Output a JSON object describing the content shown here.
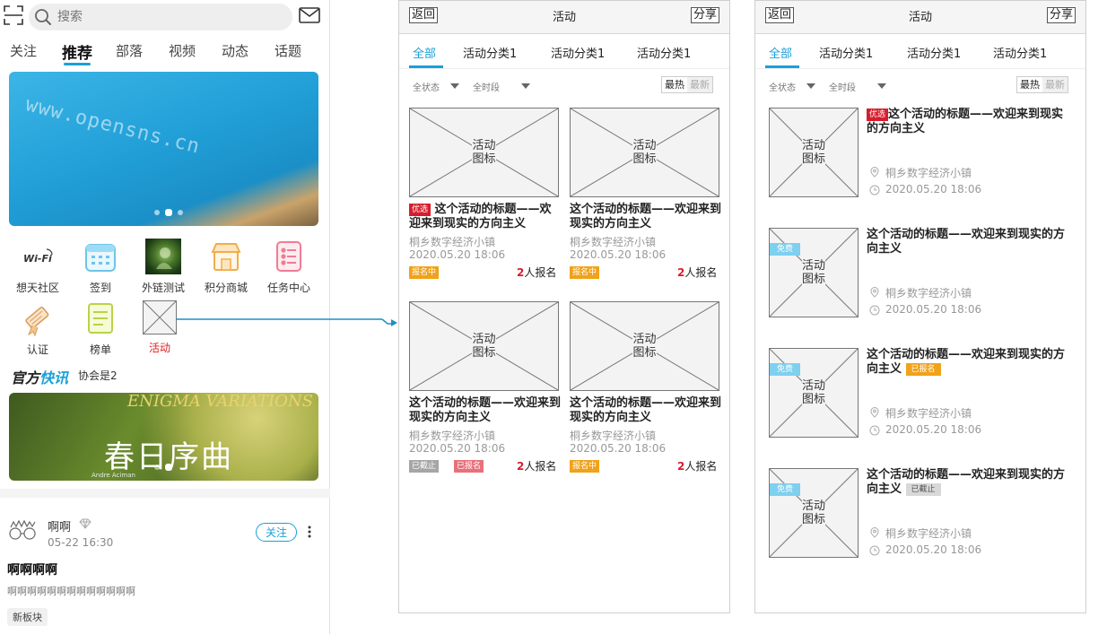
{
  "left": {
    "search_placeholder": "搜索",
    "tabs": [
      "关注",
      "推荐",
      "部落",
      "视频",
      "动态",
      "话题"
    ],
    "banner_watermark": "www.opensns.cn",
    "grid": [
      {
        "label": "想天社区",
        "icon": "wifi-logo-icon"
      },
      {
        "label": "签到",
        "icon": "calendar-icon"
      },
      {
        "label": "外链测试",
        "icon": "thumbnail-image-icon"
      },
      {
        "label": "积分商城",
        "icon": "shop-icon"
      },
      {
        "label": "任务中心",
        "icon": "checklist-icon"
      },
      {
        "label": "认证",
        "icon": "certificate-icon"
      },
      {
        "label": "榜单",
        "icon": "ranking-icon"
      },
      {
        "label": "活动",
        "icon": "placeholder-icon"
      }
    ],
    "news": {
      "logo_a": "官方",
      "logo_b": "快讯",
      "text": "协会是2"
    },
    "banner2": {
      "en": "ENIGMA VARIATIONS",
      "cn": "春日序曲",
      "sig": "Andre Aciman"
    },
    "post": {
      "user": "啊啊",
      "time": "05-22 16:30",
      "follow": "关注",
      "title": "啊啊啊啊",
      "body": "啊啊啊啊啊啊啊啊啊啊啊啊啊",
      "tag": "新板块"
    }
  },
  "screen": {
    "back": "返回",
    "title": "活动",
    "share": "分享",
    "tabs": [
      "全部",
      "活动分类1",
      "活动分类1",
      "活动分类1"
    ],
    "filters": [
      "全状态",
      "全时段"
    ],
    "sort": [
      "最热",
      "最新"
    ],
    "placeholder": [
      "活动",
      "图标"
    ]
  },
  "grid_cards": [
    {
      "badge": "优选",
      "title": "这个活动的标题——欢迎来到现实的方向主义",
      "place": "桐乡数字经济小镇",
      "date": "2020.05.20 18:06",
      "status": [
        "报名中"
      ],
      "count": "2",
      "count_suffix": "人报名"
    },
    {
      "badge": "",
      "title": "这个活动的标题——欢迎来到现实的方向主义",
      "place": "桐乡数字经济小镇",
      "date": "2020.05.20 18:06",
      "status": [
        "报名中"
      ],
      "count": "2",
      "count_suffix": "人报名"
    },
    {
      "badge": "",
      "title": "这个活动的标题——欢迎来到现实的方向主义",
      "place": "桐乡数字经济小镇",
      "date": "2020.05.20 18:06",
      "status": [
        "已截止",
        "已报名"
      ],
      "count": "2",
      "count_suffix": "人报名"
    },
    {
      "badge": "",
      "title": "这个活动的标题——欢迎来到现实的方向主义",
      "place": "桐乡数字经济小镇",
      "date": "2020.05.20 18:06",
      "status": [
        "报名中"
      ],
      "count": "2",
      "count_suffix": "人报名"
    }
  ],
  "list_cards": [
    {
      "corner": "",
      "badge": "优选",
      "title": "这个活动的标题——欢迎来到现实的方向主义",
      "status": "",
      "place": "桐乡数字经济小镇",
      "date": "2020.05.20 18:06"
    },
    {
      "corner": "免费",
      "badge": "",
      "title": "这个活动的标题——欢迎来到现实的方向主义",
      "status": "",
      "place": "桐乡数字经济小镇",
      "date": "2020.05.20 18:06"
    },
    {
      "corner": "免费",
      "badge": "",
      "title": "这个活动的标题——欢迎来到现实的方向主义",
      "status": "已报名",
      "place": "桐乡数字经济小镇",
      "date": "2020.05.20 18:06"
    },
    {
      "corner": "免费",
      "badge": "",
      "title": "这个活动的标题——欢迎来到现实的方向主义",
      "status": "已截止",
      "place": "桐乡数字经济小镇",
      "date": "2020.05.20 18:06"
    }
  ],
  "colors": {
    "accent": "#1aa0d8",
    "badge_red": "#d71d2d",
    "status_orange": "#f0a21a"
  }
}
